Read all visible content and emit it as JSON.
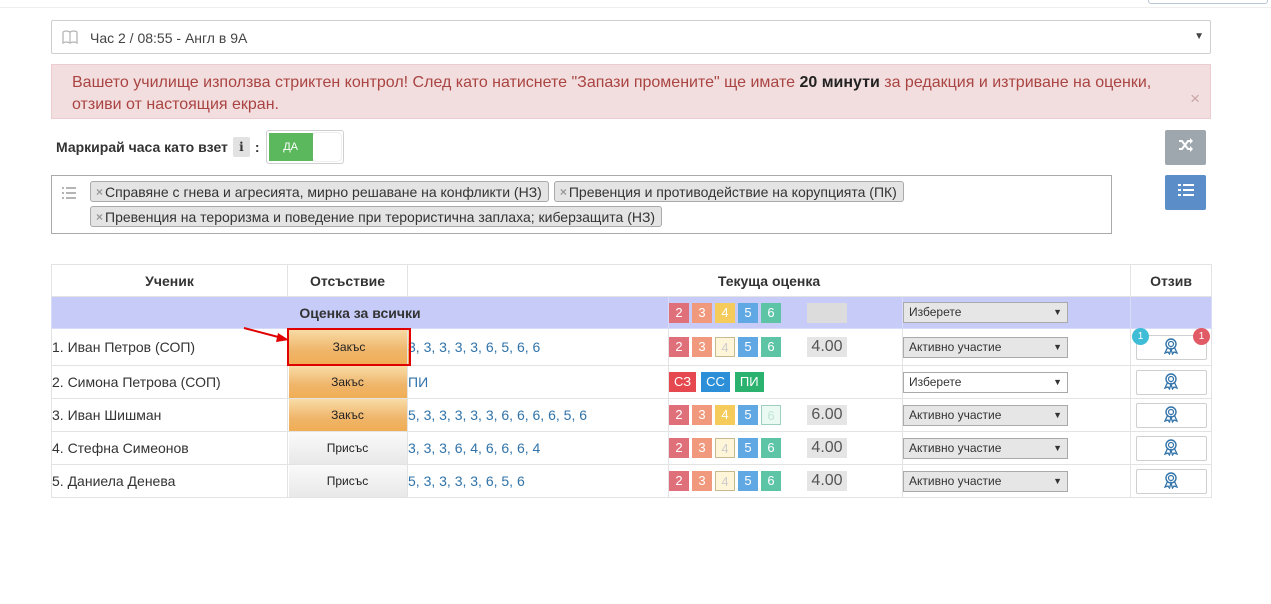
{
  "lesson": {
    "label": "Час 2 / 08:55 - Англ в 9А",
    "icon": "book-icon"
  },
  "alert": {
    "text_before": "Вашето училище използва стриктен контрол! След като натиснете \"Запази промените\" ще имате ",
    "text_bold": "20 минути",
    "text_after": " за редакция и изтриване на оценки, отзиви от настоящия екран.",
    "close": "×"
  },
  "mark_taken": {
    "label": "Маркирай часа като взет",
    "info": "i",
    "colon": ":",
    "toggle_on": "ДА"
  },
  "topics": [
    "Справяне с гнева и агресията, мирно решаване на конфликти (НЗ)",
    "Превенция и противодействие на корупцията (ПК)",
    "Превенция на тероризма и поведение при терористична заплаха; киберзащита (НЗ)"
  ],
  "table": {
    "headers": {
      "student": "Ученик",
      "absence": "Отсъствие",
      "current_grade": "Текуща оценка",
      "review": "Отзив"
    },
    "all_row": {
      "label": "Оценка за всички",
      "select": "Изберете"
    },
    "grade_buttons": [
      "2",
      "3",
      "4",
      "5",
      "6"
    ],
    "text_buttons": [
      "СЗ",
      "СС",
      "ПИ"
    ],
    "rows": [
      {
        "name": "1. Иван Петров (СОП)",
        "absence": "Закъс",
        "grades": "3, 3, 3, 3, 3, 6, 5, 6, 6",
        "average": "4.00",
        "select": "Активно участие",
        "badge_left": "1",
        "badge_right": "1"
      },
      {
        "name": "2. Симона Петрова (СОП)",
        "absence": "Закъс",
        "grades": "ПИ",
        "average": "",
        "select": "Изберете"
      },
      {
        "name": "3. Иван Шишман",
        "absence": "Закъс",
        "grades": "5, 3, 3, 3, 3, 3, 6, 6, 6, 6, 5, 6",
        "average": "6.00",
        "select": "Активно участие"
      },
      {
        "name": "4. Стефна Симеонов",
        "absence": "Присъс",
        "grades": "3, 3, 3, 6, 4, 6, 6, 6, 4",
        "average": "4.00",
        "select": "Активно участие"
      },
      {
        "name": "5. Даниела Денева",
        "absence": "Присъс",
        "grades": "5, 3, 3, 3, 3, 6, 5, 6",
        "average": "4.00",
        "select": "Активно участие"
      }
    ]
  },
  "colors": {
    "alert_bg": "#f2dede",
    "toggle_on": "#5cb85c",
    "all_row_bg": "#c6cbf7",
    "late": "#f0ad55",
    "highlight": "#e00000"
  }
}
